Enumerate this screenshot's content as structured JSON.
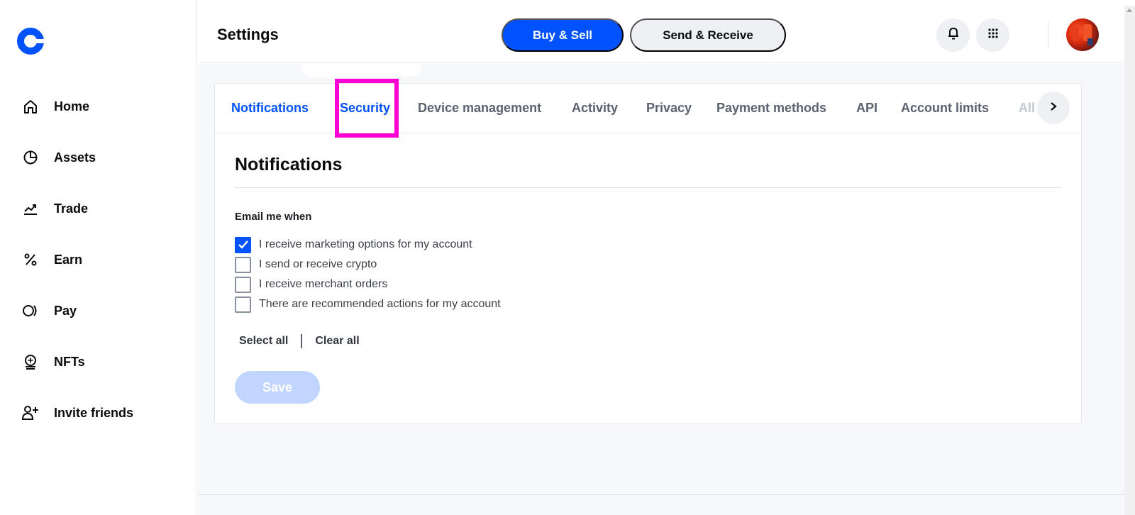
{
  "brand": {
    "accent_color": "#0052ff",
    "logo_icon": "coinbase-logo-icon"
  },
  "sidebar": {
    "items": [
      {
        "label": "Home",
        "icon": "home-icon"
      },
      {
        "label": "Assets",
        "icon": "pie-chart-icon"
      },
      {
        "label": "Trade",
        "icon": "trend-up-icon"
      },
      {
        "label": "Earn",
        "icon": "percent-icon"
      },
      {
        "label": "Pay",
        "icon": "pay-icon"
      },
      {
        "label": "NFTs",
        "icon": "nft-icon"
      },
      {
        "label": "Invite friends",
        "icon": "add-user-icon"
      }
    ]
  },
  "header": {
    "title": "Settings",
    "buy_sell_label": "Buy & Sell",
    "send_receive_label": "Send & Receive",
    "notifications_icon": "bell-icon",
    "apps_icon": "grid-icon",
    "avatar": "user-avatar"
  },
  "tabs": {
    "items": [
      {
        "label": "Notifications",
        "active": true
      },
      {
        "label": "Security",
        "active": false
      },
      {
        "label": "Device management",
        "active": false
      },
      {
        "label": "Activity",
        "active": false
      },
      {
        "label": "Privacy",
        "active": false
      },
      {
        "label": "Payment methods",
        "active": false
      },
      {
        "label": "API",
        "active": false
      },
      {
        "label": "Account limits",
        "active": false
      },
      {
        "label": "All",
        "active": false
      }
    ],
    "next_icon": "chevron-right-icon"
  },
  "notifications": {
    "title": "Notifications",
    "group_label": "Email me when",
    "options": [
      {
        "label": "I receive marketing options for my account",
        "checked": true
      },
      {
        "label": "I send or receive crypto",
        "checked": false
      },
      {
        "label": "I receive merchant orders",
        "checked": false
      },
      {
        "label": "There are recommended actions for my account",
        "checked": false
      }
    ],
    "select_all_label": "Select all",
    "clear_all_label": "Clear all",
    "save_label": "Save"
  }
}
